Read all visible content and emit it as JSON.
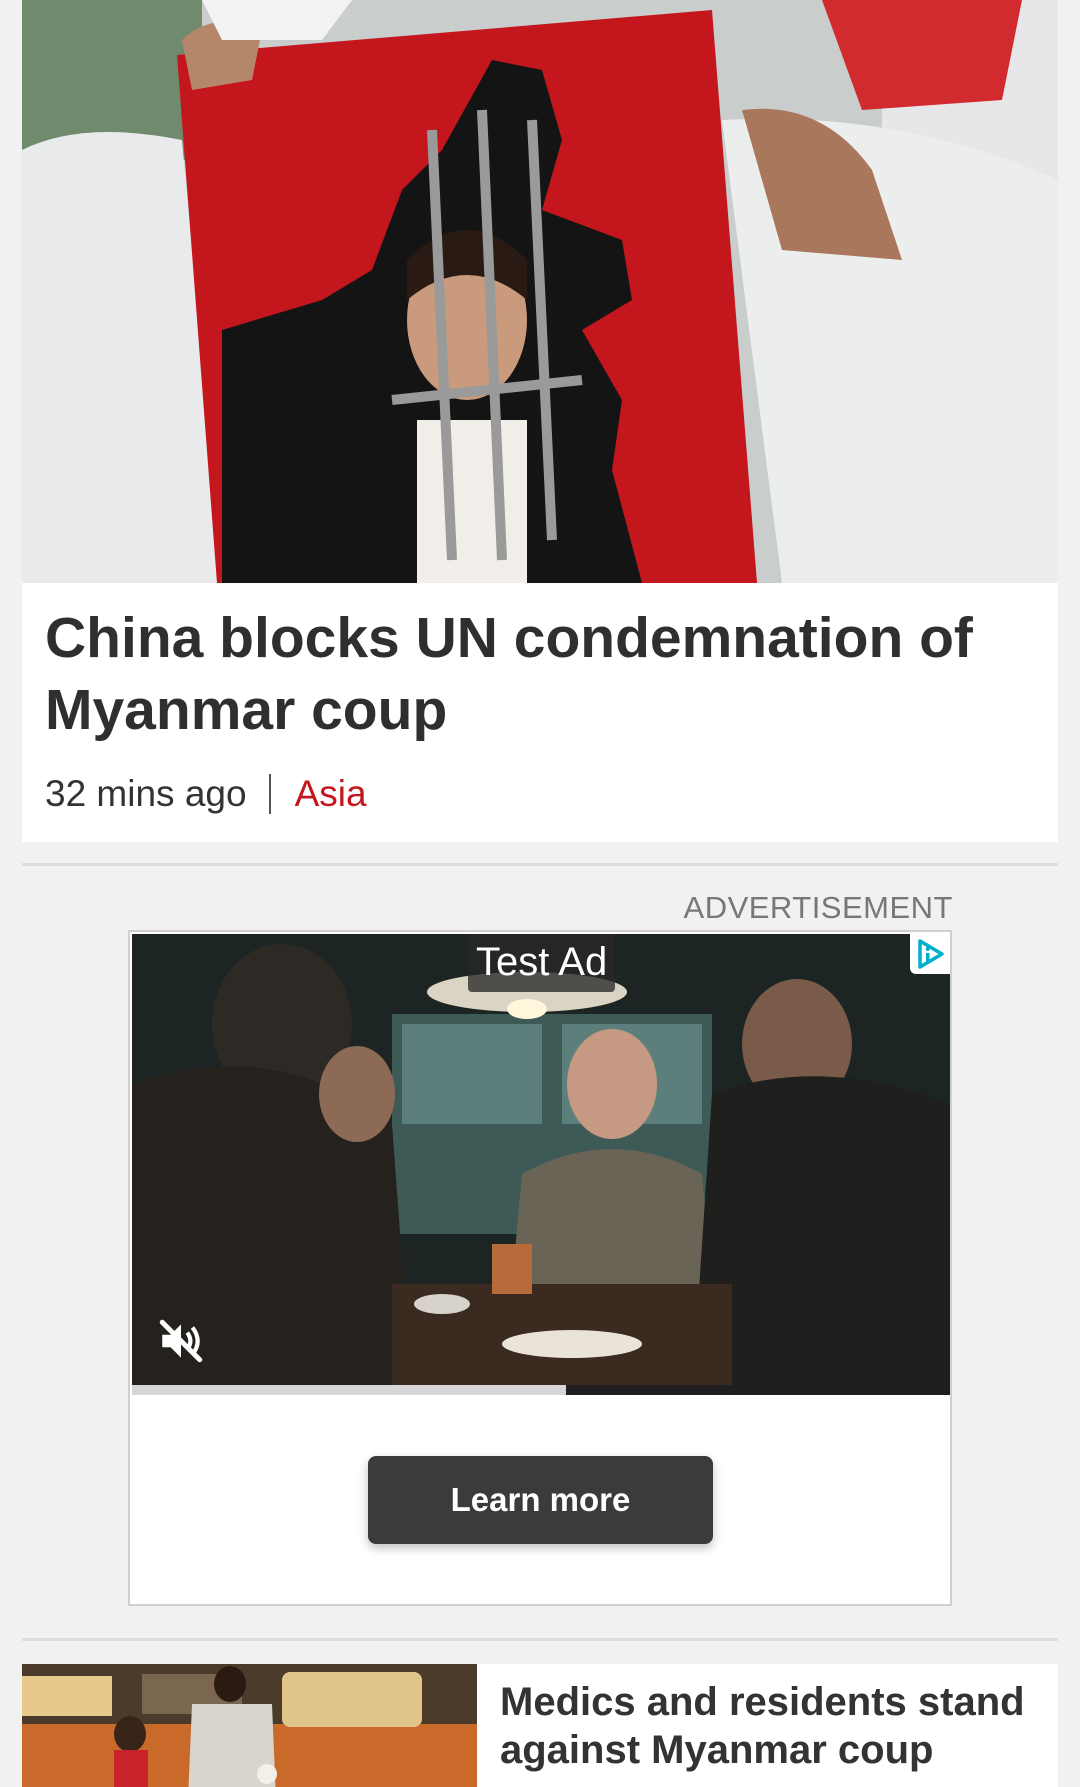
{
  "lead_story": {
    "title": "China blocks UN condemnation of Myanmar coup",
    "time_ago": "32 mins ago",
    "section": "Asia",
    "section_color": "#c4161c",
    "image_icon": "protest-poster-photo"
  },
  "advertisement": {
    "label": "ADVERTISEMENT",
    "tag": "Test Ad",
    "cta_label": "Learn more",
    "adchoices_icon": "adchoices-icon",
    "mute_icon": "volume-muted-icon",
    "progress": 0.53
  },
  "second_story": {
    "title": "Medics and residents stand against Myanmar coup",
    "image_icon": "street-scene-photo"
  },
  "colors": {
    "background": "#f1f1f1",
    "card": "#ffffff",
    "accent": "#c4161c",
    "button": "#3a3b3d",
    "adchoices": "#00aecd"
  }
}
